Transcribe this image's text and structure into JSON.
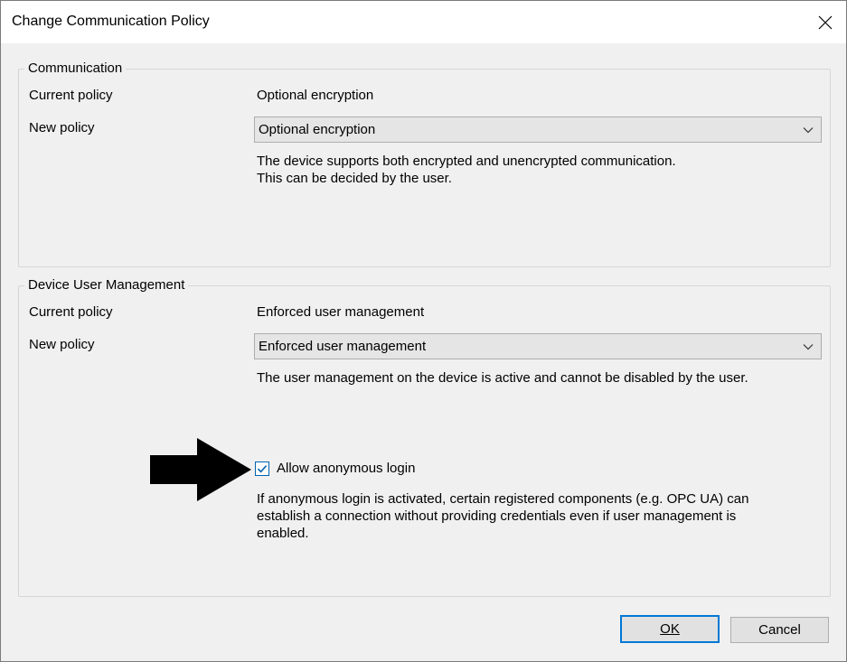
{
  "window": {
    "title": "Change Communication Policy"
  },
  "communication": {
    "group_label": "Communication",
    "current_policy_label": "Current policy",
    "current_policy_value": "Optional encryption",
    "new_policy_label": "New policy",
    "new_policy_selected": "Optional encryption",
    "description_line1": "The device supports both encrypted and unencrypted communication.",
    "description_line2": "This can be decided by the user."
  },
  "user_management": {
    "group_label": "Device User Management",
    "current_policy_label": "Current policy",
    "current_policy_value": "Enforced user management",
    "new_policy_label": "New policy",
    "new_policy_selected": "Enforced user management",
    "description": "The user management on the device is active and cannot be disabled by the user.",
    "anonymous_login": {
      "label": "Allow anonymous login",
      "checked": true,
      "description_line1": "If anonymous login is activated, certain registered components (e.g. OPC UA) can",
      "description_line2": "establish a connection without providing credentials even if user management is",
      "description_line3": "enabled."
    }
  },
  "buttons": {
    "ok_label": "OK",
    "cancel_label": "Cancel"
  },
  "icons": {
    "close": "close-icon",
    "dropdown": "chevron-down-icon",
    "checkmark": "checkmark-icon",
    "annotation_arrow": "arrow-right-icon"
  },
  "colors": {
    "accent": "#0078d7",
    "dialog_bg": "#f0f0f0",
    "dropdown_bg": "#e5e5e5"
  }
}
